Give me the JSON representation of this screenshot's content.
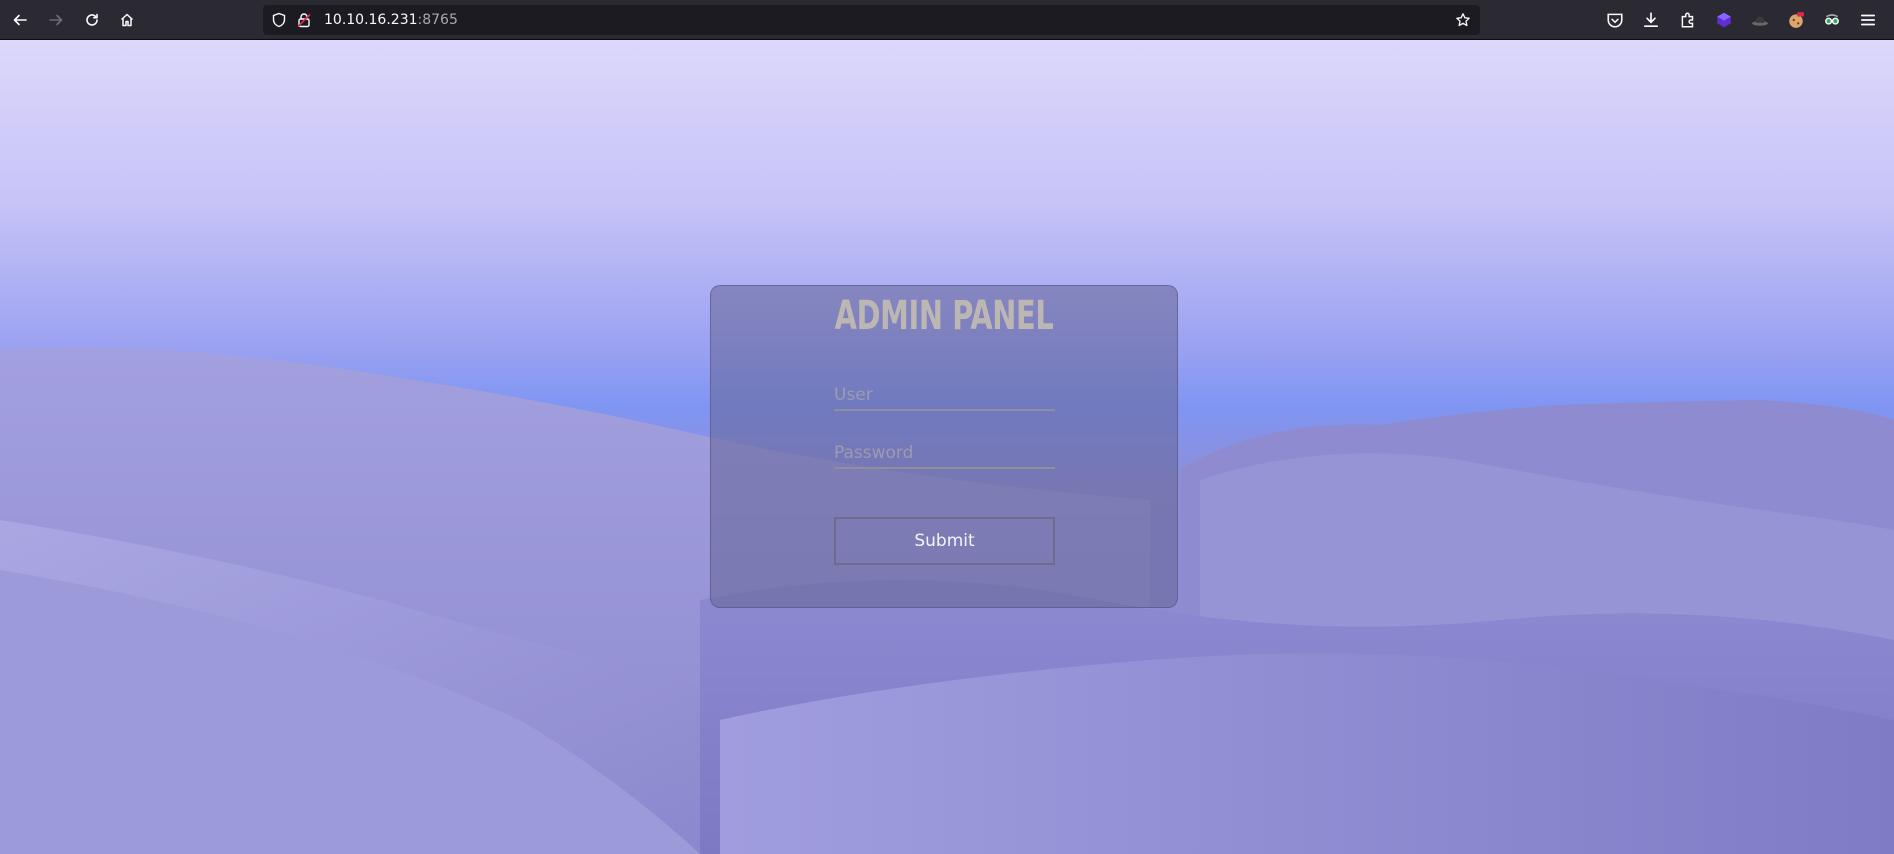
{
  "browser": {
    "url_host": "10.10.16.231",
    "url_port": ":8765",
    "nav_icons": [
      "back-icon",
      "forward-icon",
      "reload-icon",
      "home-icon"
    ],
    "url_icons": [
      "shield-icon",
      "insecure-lock-icon",
      "bookmark-star-icon"
    ],
    "extension_icons": [
      "pocket-icon",
      "downloads-icon",
      "extensions-icon",
      "purple-cube-extension-icon",
      "hat-extension-icon",
      "cookie-extension-icon",
      "glasses-extension-icon",
      "menu-icon"
    ]
  },
  "page": {
    "panel_title": "ADMIN PANEL",
    "user_placeholder": "User",
    "password_placeholder": "Password",
    "submit_label": "Submit",
    "colors": {
      "sky_top": "#dcd8fb",
      "dunes": "#8a87cc",
      "panel": "#646496",
      "title_text": "#bdb7b4"
    }
  }
}
